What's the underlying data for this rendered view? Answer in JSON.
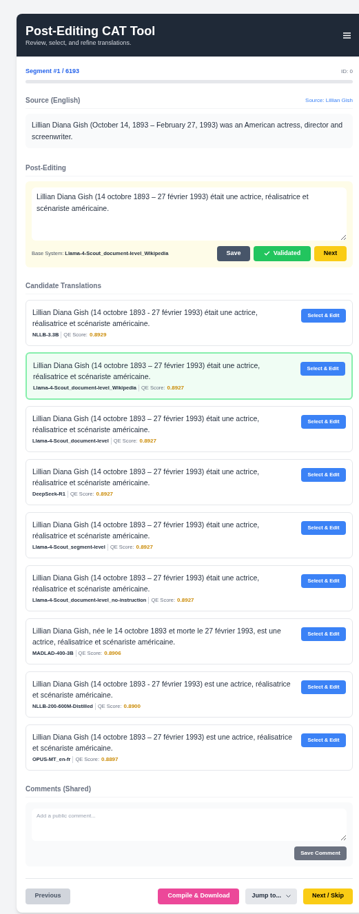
{
  "header": {
    "title": "Post-Editing CAT Tool",
    "subtitle": "Review, select, and refine translations."
  },
  "segment": {
    "label": "Segment #1 / 6193",
    "id": "ID: 0",
    "level": 0.0
  },
  "source": {
    "heading": "Source (English)",
    "link": "Source: Lillian Gish",
    "text": "Lillian Diana Gish (October 14, 1893 – February 27, 1993) was an American actress, director and screenwriter."
  },
  "post_editing": {
    "heading": "Post-Editing",
    "value": "Lillian Diana Gish (14 octobre 1893 – 27 février 1993) était une actrice, réalisatrice et scénariste américaine.",
    "base_label": "Base System:",
    "base_system": "Llama-4-Scout_document-level_Wikipedia",
    "buttons": {
      "save": "Save",
      "validate": "Validated",
      "next": "Next"
    },
    "validated": true
  },
  "candidates": {
    "heading": "Candidate Translations",
    "items": [
      {
        "text": "Lillian Diana Gish (14 octobre 1893 - 27 février 1993) était une actrice, réalisatrice et scénariste américaine.",
        "system": "NLLB-3.3B",
        "score_label": "QE Score:",
        "score": "0.8929",
        "button": "Select & Edit",
        "selected": false
      },
      {
        "text": "Lillian Diana Gish (14 octobre 1893 – 27 février 1993) était une actrice, réalisatrice et scénariste américaine.",
        "system": "Llama-4-Scout_document-level_Wikipedia",
        "score_label": "QE Score:",
        "score": "0.8927",
        "button": "Select & Edit",
        "selected": true
      },
      {
        "text": "Lillian Diana Gish (14 octobre 1893 – 27 février 1993) était une actrice, réalisatrice et scénariste américaine.",
        "system": "Llama-4-Scout_document-level",
        "score_label": "QE Score:",
        "score": "0.8927",
        "button": "Select & Edit",
        "selected": false
      },
      {
        "text": "Lillian Diana Gish (14 octobre 1893 – 27 février 1993) était une actrice, réalisatrice et scénariste américaine.",
        "system": "DeepSeek-R1",
        "score_label": "QE Score:",
        "score": "0.8927",
        "button": "Select & Edit",
        "selected": false
      },
      {
        "text": "Lillian Diana Gish (14 octobre 1893 – 27 février 1993) était une actrice, réalisatrice et scénariste américaine.",
        "system": "Llama-4-Scout_segment-level",
        "score_label": "QE Score:",
        "score": "0.8927",
        "button": "Select & Edit",
        "selected": false
      },
      {
        "text": "Lillian Diana Gish (14 octobre 1893 – 27 février 1993) était une actrice, réalisatrice et scénariste américaine.",
        "system": "Llama-4-Scout_document-level_no-instruction",
        "score_label": "QE Score:",
        "score": "0.8927",
        "button": "Select & Edit",
        "selected": false
      },
      {
        "text": "Lillian Diana Gish, née le 14 octobre 1893 et morte le 27 février 1993, est une actrice, réalisatrice et scénariste américaine.",
        "system": "MADLAD-400-3B",
        "score_label": "QE Score:",
        "score": "0.8906",
        "button": "Select & Edit",
        "selected": false
      },
      {
        "text": "Lillian Diana Gish (14 octobre 1893 - 27 février 1993) est une actrice, réalisatrice et scénariste américaine.",
        "system": "NLLB-200-600M-Distilled",
        "score_label": "QE Score:",
        "score": "0.8900",
        "button": "Select & Edit",
        "selected": false
      },
      {
        "text": "Lillian Diana Gish (14 octobre 1893 – 27 février 1993) est une actrice, réalisatrice et scénariste américaine.",
        "system": "OPUS-MT_en-fr",
        "score_label": "QE Score:",
        "score": "0.8897",
        "button": "Select & Edit",
        "selected": false
      }
    ]
  },
  "comments": {
    "heading": "Comments (Shared)",
    "placeholder": "Add a public comment...",
    "button": "Save Comment"
  },
  "footer": {
    "previous": {
      "label": "Previous",
      "disabled": true
    },
    "compile": "Compile & Download",
    "jump": "Jump to...",
    "next": "Next / Skip"
  }
}
